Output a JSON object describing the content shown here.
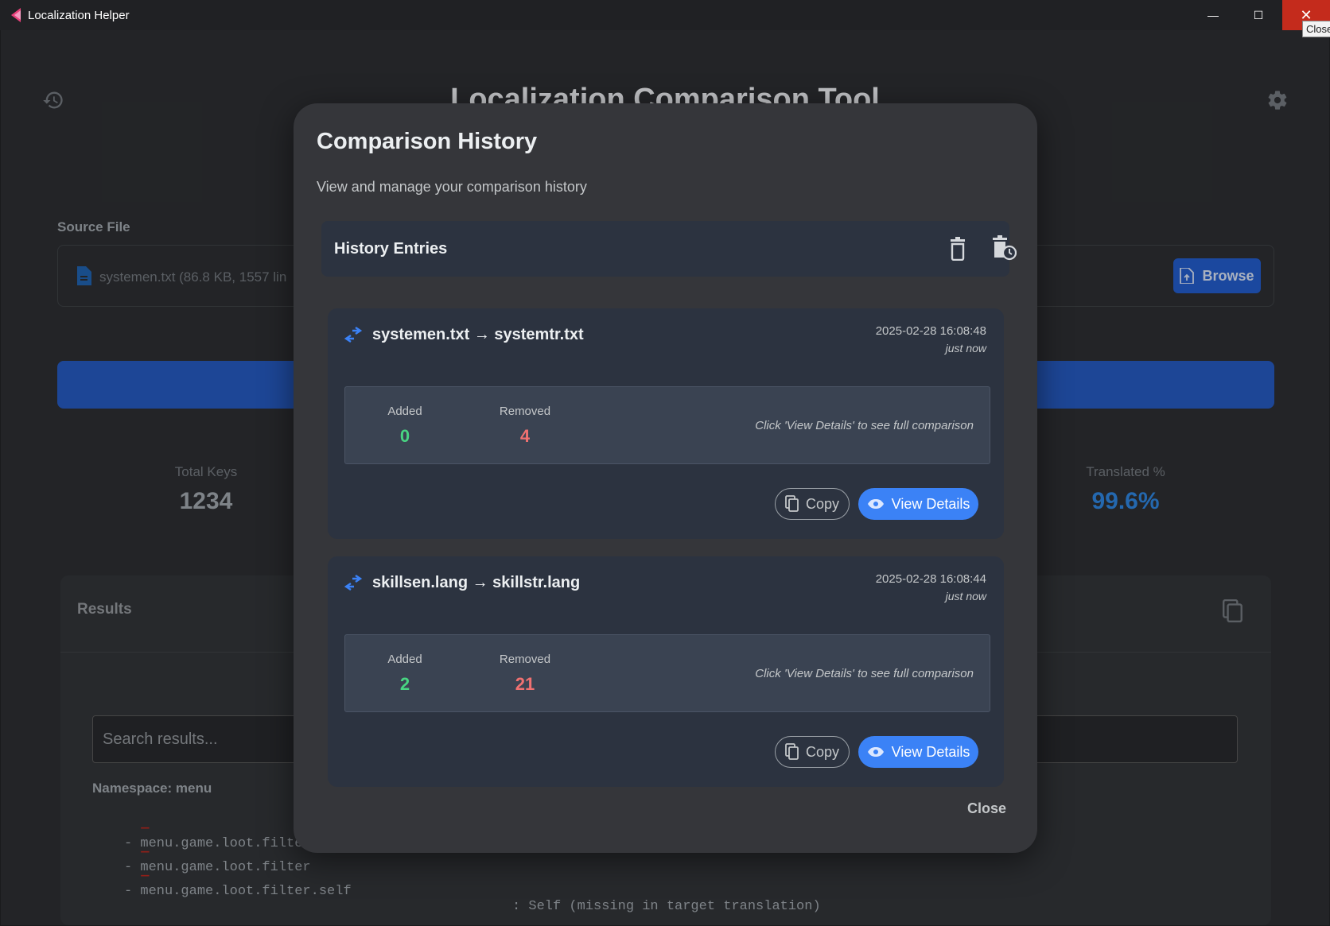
{
  "window": {
    "title": "Localization Helper",
    "tooltip": "Close",
    "minimize_glyph": "—",
    "maximize_glyph": "☐",
    "close_glyph": "✕"
  },
  "app": {
    "title": "Localization Comparison Tool",
    "source_label": "Source File",
    "source_value": "systemen.txt (86.8 KB, 1557 lin",
    "browse_label": "Browse",
    "stats": {
      "total_keys_label": "Total Keys",
      "total_keys_value": "1234",
      "translated_label": "Translated %",
      "translated_value": "99.6%"
    },
    "results": {
      "title": "Results",
      "search_placeholder": "Search results...",
      "namespace": "Namespace: menu",
      "rows": [
        {
          "dash": "—",
          "key": "- menu.game.loot.filte",
          "value": ""
        },
        {
          "dash": "—",
          "key": "- menu.game.loot.filter",
          "value": ""
        },
        {
          "dash": "—",
          "key": "- menu.game.loot.filter.self",
          "value": ": Self (missing in target translation)"
        }
      ]
    }
  },
  "modal": {
    "title": "Comparison History",
    "subtitle": "View and manage your comparison history",
    "entries_title": "History Entries",
    "close_label": "Close",
    "entries": [
      {
        "title": "systemen.txt → systemtr.txt",
        "date": "2025-02-28 16:08:48",
        "ago": "just now",
        "added_label": "Added",
        "added_value": "0",
        "removed_label": "Removed",
        "removed_value": "4",
        "hint": "Click 'View Details' to see full comparison",
        "copy_label": "Copy",
        "view_label": "View Details"
      },
      {
        "title": "skillsen.lang → skillstr.lang",
        "date": "2025-02-28 16:08:44",
        "ago": "just now",
        "added_label": "Added",
        "added_value": "2",
        "removed_label": "Removed",
        "removed_value": "21",
        "hint": "Click 'View Details' to see full comparison",
        "copy_label": "Copy",
        "view_label": "View Details"
      }
    ]
  },
  "colors": {
    "accent": "#3b82f6",
    "added": "#48d582",
    "removed": "#f07171",
    "close_button": "#c42b1c"
  }
}
